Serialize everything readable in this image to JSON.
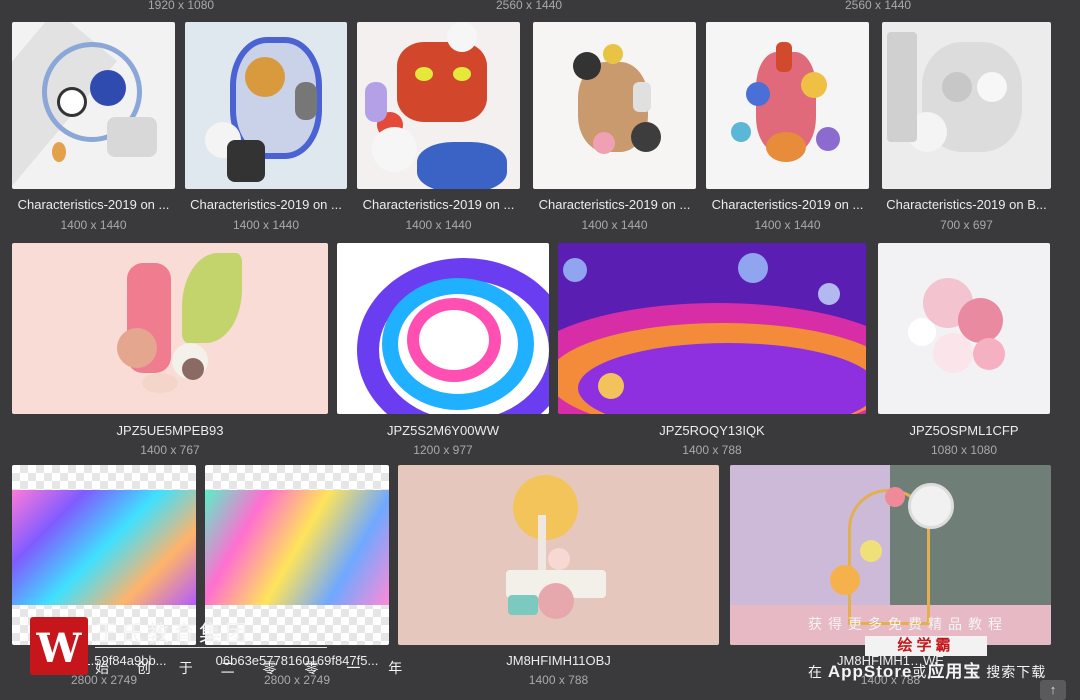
{
  "top_dims": [
    "1920 x 1080",
    "2560 x 1440",
    "2560 x 1440"
  ],
  "row1": [
    {
      "caption": "Characteristics-2019 on ...",
      "dims": "1400 x 1440"
    },
    {
      "caption": "Characteristics-2019 on ...",
      "dims": "1400 x 1440"
    },
    {
      "caption": "Characteristics-2019 on ...",
      "dims": "1400 x 1440"
    },
    {
      "caption": "Characteristics-2019 on ...",
      "dims": "1400 x 1440"
    },
    {
      "caption": "Characteristics-2019 on ...",
      "dims": "1400 x 1440"
    },
    {
      "caption": "Characteristics-2019 on B...",
      "dims": "700 x 697"
    }
  ],
  "row2": [
    {
      "caption": "JPZ5UE5MPEB93",
      "dims": "1400 x 767"
    },
    {
      "caption": "JPZ5S2M6Y00WW",
      "dims": "1200 x 977"
    },
    {
      "caption": "JPZ5ROQY13IQK",
      "dims": "1400 x 788"
    },
    {
      "caption": "JPZ5OSPML1CFP",
      "dims": "1080 x 1080"
    }
  ],
  "row3": [
    {
      "caption": "70…601.59f84a9bb...",
      "dims": "2800 x 2749"
    },
    {
      "caption": "06b63e5778160169f847f5...",
      "dims": "2800 x 2749"
    },
    {
      "caption": "JM8HFIMH11OBJ",
      "dims": "1400 x 788"
    },
    {
      "caption": "JM8HFIMH1…WE",
      "dims": "1400 x 788"
    }
  ],
  "watermark": {
    "logo_letter": "W",
    "title": "王氏教育集团",
    "subtitle": "始 创 于 二 零 零 一 年",
    "right_line1": "获得更多免费精品教程",
    "badge": "绘学霸",
    "right_line2_prefix": "在",
    "right_line2_bold": "AppStore",
    "right_line2_mid": "或",
    "right_line2_bold2": "应用宝",
    "right_line2_suffix": "搜索下载"
  },
  "scroll_top_icon": "↑",
  "colors": {
    "background": "#3a3a3c",
    "accent_red": "#c6161c"
  }
}
